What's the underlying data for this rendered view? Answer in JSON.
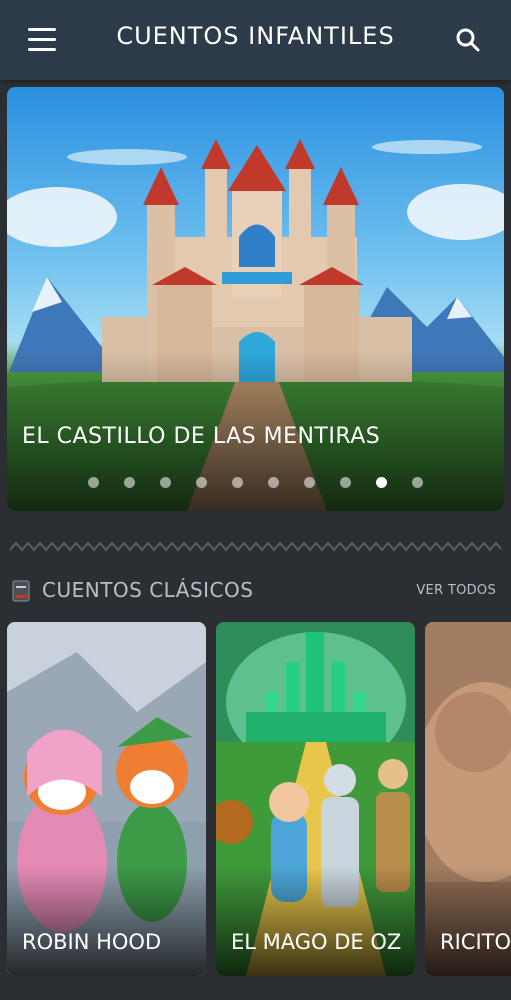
{
  "app": {
    "title": "CUENTOS INFANTILES",
    "icons": {
      "menu": "menu-icon",
      "search": "search-icon"
    }
  },
  "hero": {
    "caption": "EL CASTILLO DE LAS MENTIRAS",
    "total_slides": 10,
    "active_slide": 9
  },
  "section": {
    "icon": "book-icon",
    "title": "CUENTOS CLÁSICOS",
    "see_all": "VER TODOS"
  },
  "cards": [
    {
      "title": "ROBIN HOOD"
    },
    {
      "title": "EL MAGO DE OZ"
    },
    {
      "title": "RICITOS"
    }
  ],
  "colors": {
    "appbar": "#2c3a49",
    "background": "#2b2e33",
    "muted_text": "#b6c0c9"
  }
}
